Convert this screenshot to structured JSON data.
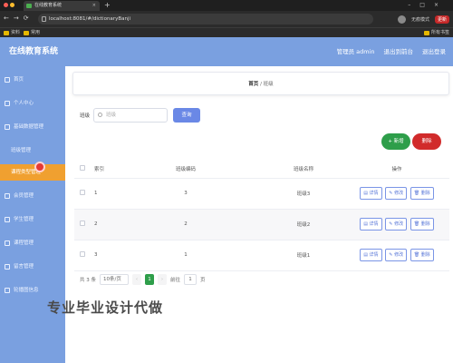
{
  "browser": {
    "tab_title": "在线教育系统",
    "url": "localhost:8081/#/dictionaryBanji",
    "incognito_label": "无痕模式",
    "update_label": "更新",
    "bookmarks": [
      "资料",
      "常用"
    ],
    "other_bookmarks": "所有书签"
  },
  "header": {
    "logo": "在线教育系统",
    "user_label": "管理员 admin",
    "back_label": "退出到前台",
    "logout_label": "退出登录"
  },
  "sidebar": {
    "items": [
      {
        "label": "首页"
      },
      {
        "label": "个人中心"
      },
      {
        "label": "基础数据管理"
      },
      {
        "label": "班级管理"
      },
      {
        "label": "课程类型管理"
      },
      {
        "label": "会员管理"
      },
      {
        "label": "学生管理"
      },
      {
        "label": "课程管理"
      },
      {
        "label": "留言管理"
      },
      {
        "label": "轮播图信息"
      }
    ],
    "active_index": 4
  },
  "breadcrumb": {
    "home": "首页",
    "separator": "/",
    "current": "班级"
  },
  "search": {
    "label": "班级",
    "placeholder": "班级",
    "button": "查询"
  },
  "actions": {
    "add": "+ 新增",
    "delete": "删除"
  },
  "table": {
    "headers": [
      "索引",
      "班级编码",
      "班级名称",
      "操作"
    ],
    "rows": [
      {
        "index": "1",
        "code": "3",
        "name": "班级3"
      },
      {
        "index": "2",
        "code": "2",
        "name": "班级2"
      },
      {
        "index": "3",
        "code": "1",
        "name": "班级1"
      }
    ],
    "op_labels": {
      "detail": "详情",
      "edit": "修改",
      "delete": "删除"
    }
  },
  "pagination": {
    "total_label": "共 3 条",
    "page_size": "10条/页",
    "prev": "‹",
    "current_page": "1",
    "next": "›",
    "goto_label": "前往",
    "goto_value": "1",
    "page_suffix": "页"
  },
  "watermark": "专业毕业设计代做",
  "colors": {
    "sidebar": "#7aa0e0",
    "active": "#f0a030",
    "add_button": "#2e9e4a",
    "delete_button": "#d12b2b",
    "search_button": "#6a88e6"
  }
}
